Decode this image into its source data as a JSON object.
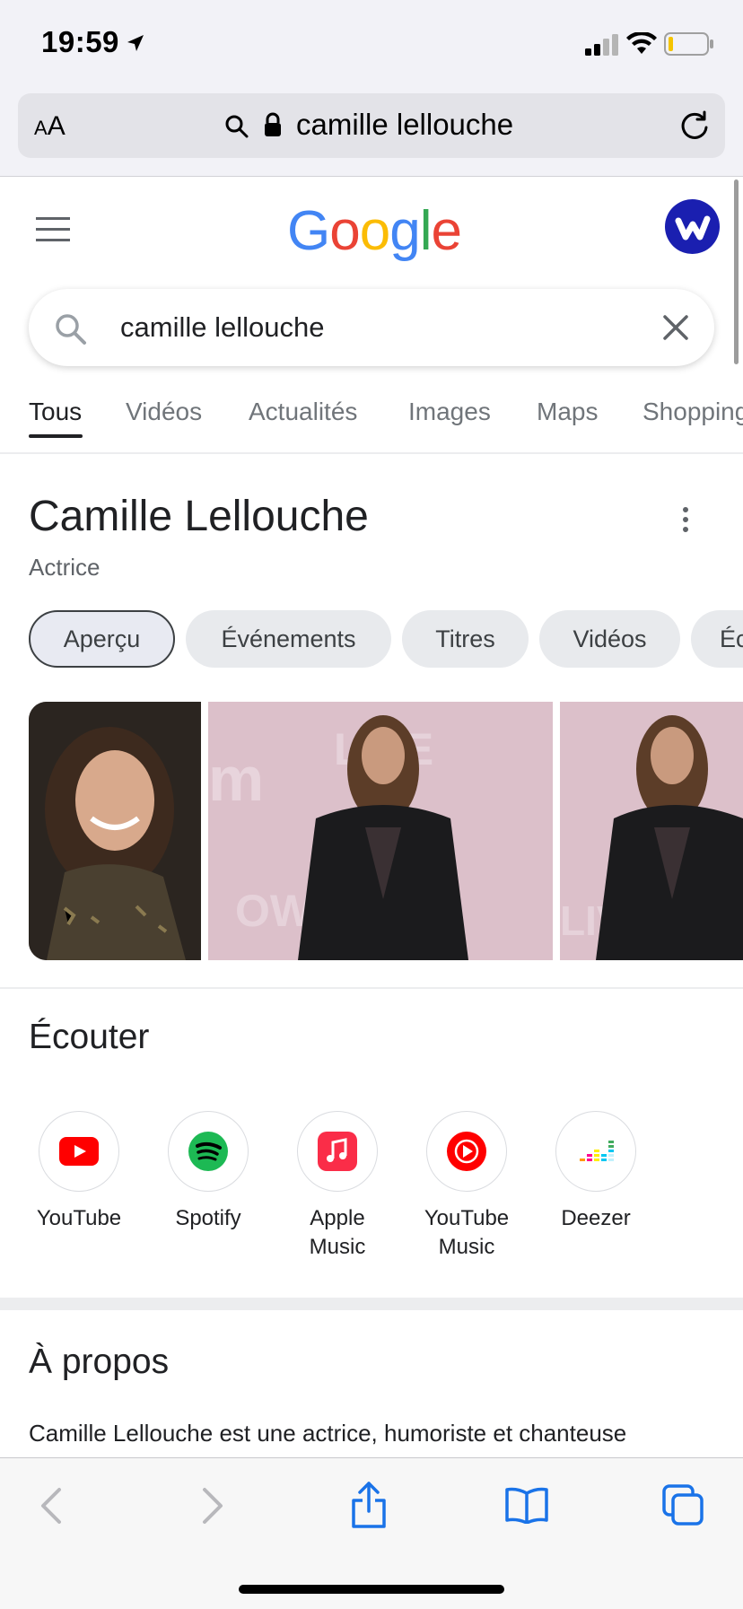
{
  "status_bar": {
    "time": "19:59"
  },
  "safari": {
    "text_size_label_small": "A",
    "text_size_label_large": "A",
    "url_text": "camille lellouche"
  },
  "google": {
    "logo_letters": [
      {
        "ch": "G",
        "color": "#4285F4"
      },
      {
        "ch": "o",
        "color": "#EA4335"
      },
      {
        "ch": "o",
        "color": "#FBBC05"
      },
      {
        "ch": "g",
        "color": "#4285F4"
      },
      {
        "ch": "l",
        "color": "#34A853"
      },
      {
        "ch": "e",
        "color": "#EA4335"
      }
    ],
    "search_value": "camille lellouche",
    "tabs": [
      {
        "label": "Tous",
        "active": true
      },
      {
        "label": "Vidéos"
      },
      {
        "label": "Actualités"
      },
      {
        "label": "Images"
      },
      {
        "label": "Maps"
      },
      {
        "label": "Shopping"
      }
    ]
  },
  "knowledge_panel": {
    "title": "Camille Lellouche",
    "subtitle": "Actrice",
    "chips": [
      {
        "label": "Aperçu",
        "active": true
      },
      {
        "label": "Événements"
      },
      {
        "label": "Titres"
      },
      {
        "label": "Vidéos"
      },
      {
        "label": "Éc"
      }
    ]
  },
  "listen": {
    "title": "Écouter",
    "services": [
      {
        "line1": "YouTube",
        "line2": "",
        "icon": "youtube-icon",
        "color": "#FF0000"
      },
      {
        "line1": "Spotify",
        "line2": "",
        "icon": "spotify-icon",
        "color": "#1DB954"
      },
      {
        "line1": "Apple",
        "line2": "Music",
        "icon": "apple-music-icon",
        "color": "#FA2D48"
      },
      {
        "line1": "YouTube",
        "line2": "Music",
        "icon": "youtube-music-icon",
        "color": "#FF0000"
      },
      {
        "line1": "Deezer",
        "line2": "",
        "icon": "deezer-icon",
        "color": "#A238FF"
      }
    ]
  },
  "about": {
    "title": "À propos",
    "text": "Camille Lellouche est une actrice, humoriste et chanteuse"
  }
}
